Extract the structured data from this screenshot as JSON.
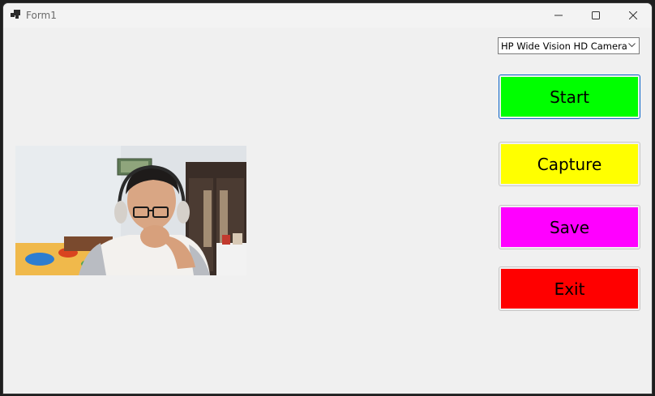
{
  "window": {
    "title": "Form1",
    "controls": [
      "minimize-icon",
      "maximize-icon",
      "close-icon"
    ]
  },
  "camera_select": {
    "selected": "HP Wide Vision HD Camera"
  },
  "buttons": {
    "start": {
      "label": "Start",
      "color": "#00ff00"
    },
    "capture": {
      "label": "Capture",
      "color": "#ffff00"
    },
    "save": {
      "label": "Save",
      "color": "#ff00ff"
    },
    "exit": {
      "label": "Exit",
      "color": "#ff0000"
    }
  },
  "camera_view": {
    "content": "webcam-preview-image"
  }
}
